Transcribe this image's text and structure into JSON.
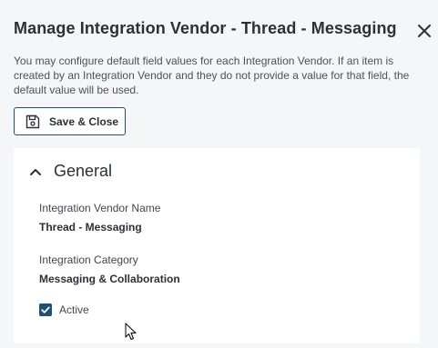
{
  "modal": {
    "title": "Manage Integration Vendor - Thread - Messaging",
    "description": "You may configure default field values for each Integration Vendor. If an item is created by an Integration Vendor and they do not provide a value for that field, the default value will be used.",
    "close_icon": "close-icon"
  },
  "toolbar": {
    "save_close_label": "Save & Close",
    "save_icon": "floppy-disk-icon"
  },
  "section": {
    "title": "General",
    "expanded": true,
    "chevron_icon": "chevron-up-icon",
    "fields": {
      "vendor_name_label": "Integration Vendor Name",
      "vendor_name_value": "Thread - Messaging",
      "category_label": "Integration Category",
      "category_value": "Messaging & Collaboration"
    },
    "active": {
      "label": "Active",
      "checked": true
    }
  },
  "colors": {
    "accent": "#1f4e79",
    "background": "#f5f6f7",
    "panel": "#ffffff",
    "text": "#2b3138"
  }
}
